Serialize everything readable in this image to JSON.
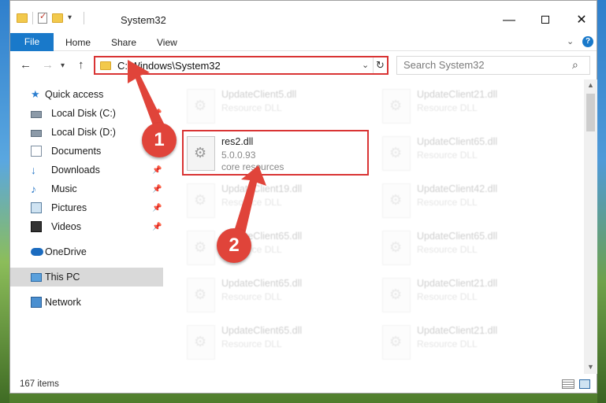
{
  "window": {
    "title": "System32"
  },
  "ribbon": {
    "tabs": [
      "File",
      "Home",
      "Share",
      "View"
    ]
  },
  "addressbar": {
    "path": "C:\\Windows\\System32"
  },
  "search": {
    "placeholder": "Search System32"
  },
  "navpane": {
    "items": [
      {
        "label": "Quick access",
        "icon": "star-icon"
      },
      {
        "label": "Local Disk (C:)",
        "icon": "drive-icon",
        "pinned": true
      },
      {
        "label": "Local Disk (D:)",
        "icon": "drive-icon"
      },
      {
        "label": "Documents",
        "icon": "documents-icon"
      },
      {
        "label": "Downloads",
        "icon": "download-icon",
        "pinned": true
      },
      {
        "label": "Music",
        "icon": "music-icon",
        "pinned": true
      },
      {
        "label": "Pictures",
        "icon": "pictures-icon",
        "pinned": true
      },
      {
        "label": "Videos",
        "icon": "videos-icon",
        "pinned": true
      },
      {
        "label": "OneDrive",
        "icon": "cloud-icon"
      },
      {
        "label": "This PC",
        "icon": "computer-icon",
        "selected": true
      },
      {
        "label": "Network",
        "icon": "network-icon"
      }
    ]
  },
  "files": {
    "highlighted": {
      "name": "res2.dll",
      "version": "5.0.0.93",
      "description": "core resources"
    },
    "left_column": [
      {
        "name": "UpdateClient5.dll",
        "type": "Resource DLL"
      },
      {
        "name": "UpdateClient19.dll",
        "type": "Resource DLL"
      },
      {
        "name": "UpdateClient65.dll",
        "type": "Resource DLL"
      },
      {
        "name": "UpdateClient65.dll",
        "type": "Resource DLL"
      },
      {
        "name": "UpdateClient65.dll",
        "type": "Resource DLL"
      }
    ],
    "right_column": [
      {
        "name": "UpdateClient21.dll",
        "type": "Resource DLL"
      },
      {
        "name": "UpdateClient65.dll",
        "type": "Resource DLL"
      },
      {
        "name": "UpdateClient42.dll",
        "type": "Resource DLL"
      },
      {
        "name": "UpdateClient65.dll",
        "type": "Resource DLL"
      },
      {
        "name": "UpdateClient21.dll",
        "type": "Resource DLL"
      },
      {
        "name": "UpdateClient21.dll",
        "type": "Resource DLL"
      }
    ]
  },
  "statusbar": {
    "item_count": "167 items"
  },
  "annotations": {
    "step1": "1",
    "step2": "2",
    "color": "#e0443a"
  }
}
